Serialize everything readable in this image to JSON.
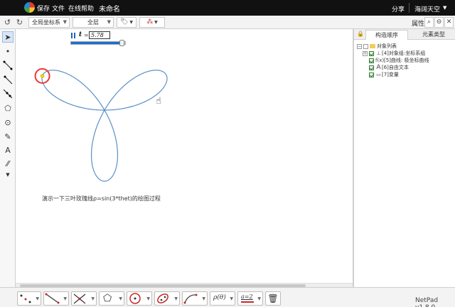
{
  "app": {
    "menu": [
      "保存",
      "文件",
      "在线帮助"
    ],
    "doc_title": "未命名",
    "share": "分享",
    "user": "海阔天空",
    "version": "NetPad v1.8.0"
  },
  "toolbar": {
    "coord_select": "全局坐标系",
    "layer_select": "全层",
    "properties_label": "属性"
  },
  "animation": {
    "param_name": "t",
    "param_value": "5.78",
    "progress": 0.92
  },
  "canvas": {
    "caption": "演示一下三叶玫瑰线ρ=sin(3*thet)的绘图过程",
    "curve_color": "#5b8fc7",
    "marker_color": "#e53935"
  },
  "right_panel": {
    "tabs": [
      "构造顺序",
      "元素类型"
    ],
    "tree": {
      "root": "对象列表",
      "items": [
        {
          "label": "[4]对象组:坐标系组",
          "icon": "axes-icon"
        },
        {
          "label": "[5]曲线: 极坐标曲线",
          "icon": "curve-icon"
        },
        {
          "label": "[6]自由文本",
          "icon": "text-icon"
        },
        {
          "label": "[7]变量",
          "icon": "variable-icon"
        }
      ]
    }
  },
  "bottom_tools": {
    "param_label": "ρ(θ)",
    "equation_label": "a=2"
  }
}
